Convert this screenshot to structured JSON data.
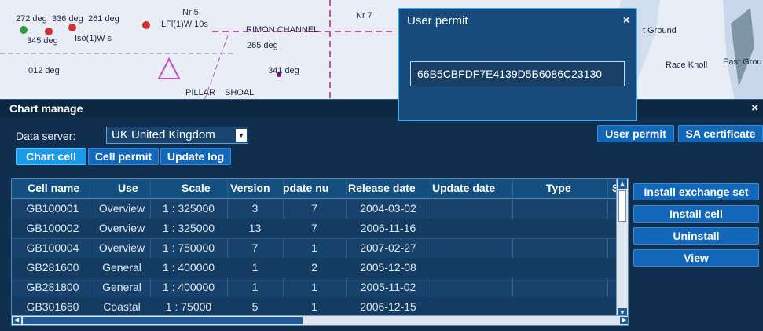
{
  "chart_bg": {
    "labels": [
      "272 deg",
      "336 deg",
      "261 deg",
      "345 deg",
      "Iso(1)W s",
      "LFl(1)W 10s",
      "Nr 5",
      "RIMON CHANNEL",
      "265 deg",
      "Nr 7",
      "012 deg",
      "341 deg",
      "PILLAR",
      "SHOAL",
      "t Ground",
      "Race Knoll",
      "East Grou"
    ]
  },
  "panel": {
    "title": "Chart manage",
    "close": "×",
    "server_label": "Data server:",
    "server_value": "UK United Kingdom",
    "buttons": {
      "user_permit": "User permit",
      "sa_certificate": "SA certificate"
    },
    "tabs": [
      "Chart cell",
      "Cell permit",
      "Update log"
    ],
    "columns": [
      "Cell name",
      "Use",
      "Scale",
      "Version",
      "pdate nu",
      "Release date",
      "Update date",
      "Type",
      "S"
    ],
    "rows": [
      [
        "GB100001",
        "Overview",
        "1 : 325000",
        "3",
        "7",
        "2004-03-02",
        "",
        ""
      ],
      [
        "GB100002",
        "Overview",
        "1 : 325000",
        "13",
        "7",
        "2006-11-16",
        "",
        ""
      ],
      [
        "GB100004",
        "Overview",
        "1 : 750000",
        "7",
        "1",
        "2007-02-27",
        "",
        ""
      ],
      [
        "GB281600",
        "General",
        "1 : 400000",
        "1",
        "2",
        "2005-12-08",
        "",
        ""
      ],
      [
        "GB281800",
        "General",
        "1 : 400000",
        "1",
        "1",
        "2005-11-02",
        "",
        ""
      ],
      [
        "GB301660",
        "Coastal",
        "1 : 75000",
        "5",
        "1",
        "2006-12-15",
        "",
        ""
      ]
    ],
    "actions": [
      "Install exchange set",
      "Install cell",
      "Uninstall",
      "View"
    ]
  },
  "dialog": {
    "title": "User permit",
    "close": "×",
    "value": "66B5CBFDF7E4139D5B6086C23130"
  }
}
